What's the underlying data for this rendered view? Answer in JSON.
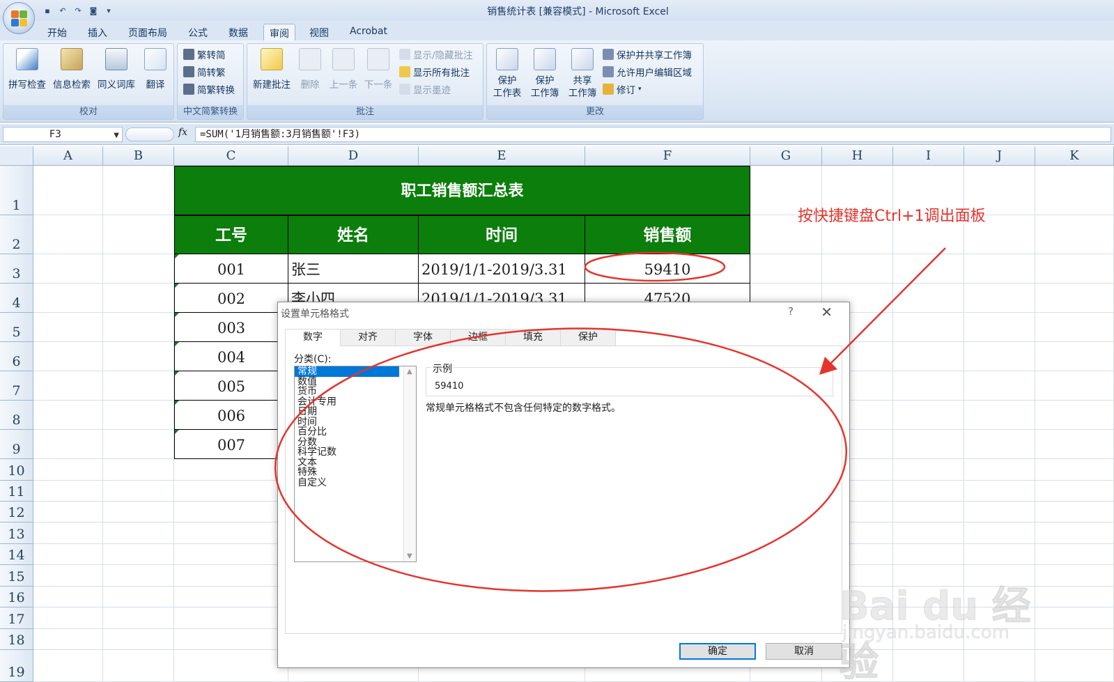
{
  "window": {
    "title": "销售统计表  [兼容模式] - Microsoft Excel"
  },
  "quick_access": [
    {
      "name": "save-icon",
      "glyph": "▪"
    },
    {
      "name": "undo-icon",
      "glyph": "↶"
    },
    {
      "name": "redo-icon",
      "glyph": "↷"
    },
    {
      "name": "camera-icon",
      "glyph": "◙"
    },
    {
      "name": "customize-icon",
      "glyph": "▾"
    }
  ],
  "tabs": [
    "开始",
    "插入",
    "页面布局",
    "公式",
    "数据",
    "审阅",
    "视图",
    "Acrobat"
  ],
  "active_tab": "审阅",
  "ribbon": {
    "proofing": {
      "label": "校对",
      "buttons": [
        "拼写检查",
        "信息检索",
        "同义词库",
        "翻译"
      ]
    },
    "chinese": {
      "label": "中文简繁转换",
      "buttons": [
        "繁转简",
        "简转繁",
        "简繁转换"
      ]
    },
    "comments": {
      "label": "批注",
      "new_comment": "新建批注",
      "delete": "删除",
      "previous": "上一条",
      "next": "下一条",
      "show_hide": "显示/隐藏批注",
      "show_all": "显示所有批注",
      "show_ink": "显示墨迹"
    },
    "changes": {
      "label": "更改",
      "protect_sheet": [
        "保护",
        "工作表"
      ],
      "protect_workbook": [
        "保护",
        "工作簿"
      ],
      "share_workbook": [
        "共享",
        "工作簿"
      ],
      "protect_share": "保护并共享工作簿",
      "allow_edit_ranges": "允许用户编辑区域",
      "track_changes": "修订"
    }
  },
  "formula_bar": {
    "name_box": "F3",
    "fx": "fx",
    "formula": "=SUM('1月销售额:3月销售额'!F3)"
  },
  "columns": [
    "A",
    "B",
    "C",
    "D",
    "E",
    "F",
    "G",
    "H",
    "I",
    "J",
    "K"
  ],
  "rows": [
    "1",
    "2",
    "3",
    "4",
    "5",
    "6",
    "7",
    "8",
    "9",
    "10",
    "11",
    "12",
    "13",
    "14",
    "15",
    "16",
    "17",
    "18",
    "19"
  ],
  "table": {
    "title": "职工销售额汇总表",
    "headers": [
      "工号",
      "姓名",
      "时间",
      "销售额"
    ],
    "rows": [
      [
        "001",
        "张三",
        "2019/1/1-2019/3.31",
        "59410"
      ],
      [
        "002",
        "李小四",
        "2019/1/1-2019/3.31",
        "47520"
      ],
      [
        "003",
        "",
        "",
        ""
      ],
      [
        "004",
        "",
        "",
        ""
      ],
      [
        "005",
        "",
        "",
        ""
      ],
      [
        "006",
        "",
        "",
        ""
      ],
      [
        "007",
        "",
        "",
        ""
      ]
    ],
    "header_color": "#0b7e0b"
  },
  "annotation": {
    "text": "按快捷键盘Ctrl+1调出面板",
    "color": "#e5342c"
  },
  "dialog": {
    "title": "设置单元格格式",
    "help": "?",
    "close": "✕",
    "tabs": [
      "数字",
      "对齐",
      "字体",
      "边框",
      "填充",
      "保护"
    ],
    "active_tab": "数字",
    "category_label": "分类(C):",
    "categories": [
      "常规",
      "数值",
      "货币",
      "会计专用",
      "日期",
      "时间",
      "百分比",
      "分数",
      "科学记数",
      "文本",
      "特殊",
      "自定义"
    ],
    "selected_category": "常规",
    "sample_label": "示例",
    "sample_value": "59410",
    "description": "常规单元格格式不包含任何特定的数字格式。",
    "ok": "确定",
    "cancel": "取消"
  },
  "watermark": {
    "brand": "Bai du 经验",
    "url": "jingyan.baidu.com"
  }
}
